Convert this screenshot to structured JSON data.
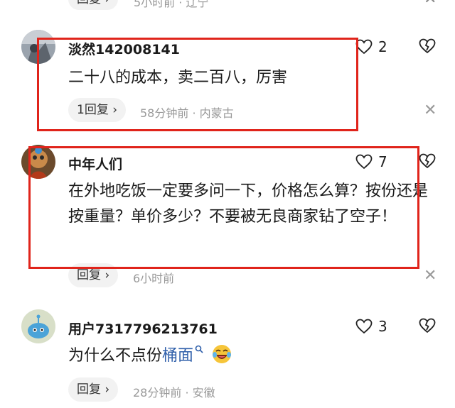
{
  "top_partial": {
    "reply_label": "回复 ›",
    "meta": "5小时前 · 辽宁"
  },
  "comments": [
    {
      "username": "淡然142008141",
      "text": "二十八的成本，卖二百八，厉害",
      "like_count": "2",
      "reply_label": "1回复 ›",
      "meta": "58分钟前 · 内蒙古"
    },
    {
      "username": "中年人们",
      "text": "在外地吃饭一定要多问一下，价格怎么算？按份还是按重量？单价多少？不要被无良商家钻了空子！",
      "like_count": "7",
      "reply_label": "回复 ›",
      "meta": "6小时前"
    },
    {
      "username": "用户7317796213761",
      "text_prefix": "为什么不点份",
      "text_link": "桶面",
      "like_count": "3",
      "reply_label": "回复 ›",
      "meta": "28分钟前 · 安徽"
    }
  ],
  "colors": {
    "highlight": "#e0241b",
    "link": "#2f5faa",
    "meta": "#999999"
  },
  "icons": [
    "heart-outline-icon",
    "broken-heart-icon",
    "close-icon",
    "search-icon",
    "laughing-emoji-icon"
  ]
}
